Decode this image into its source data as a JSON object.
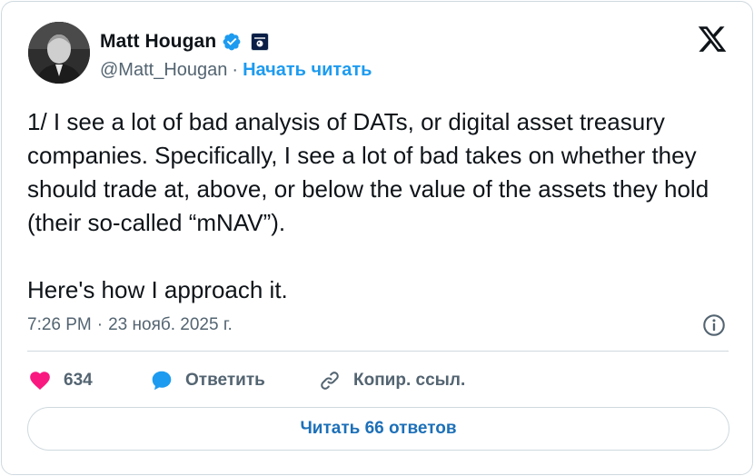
{
  "author": {
    "name": "Matt Hougan",
    "handle": "@Matt_Hougan",
    "separator": "·",
    "follow_label": "Начать читать"
  },
  "tweet": {
    "text": "1/ I see a lot of bad analysis of DATs, or digital asset treasury companies. Specifically, I see a lot of bad takes on whether they should trade at, above, or below the value of the assets they hold (their so-called “mNAV”).\n\nHere's how I approach it.",
    "time": "7:26 PM",
    "separator": "·",
    "date": "23 нояб. 2025 г."
  },
  "actions": {
    "like_count": "634",
    "reply_label": "Ответить",
    "copy_link_label": "Копир. ссыл."
  },
  "read_replies_label": "Читать 66 ответов",
  "icons": {
    "verified": "verified-badge-icon",
    "affiliate": "affiliate-badge-icon",
    "brand": "x-logo-icon",
    "info": "info-icon",
    "like": "heart-icon",
    "reply": "speech-bubble-icon",
    "copy_link": "link-icon"
  },
  "colors": {
    "text": "#0f1419",
    "secondary": "#536471",
    "accent": "#1d9bf0",
    "like": "#f91880",
    "border": "#cfd9de"
  }
}
